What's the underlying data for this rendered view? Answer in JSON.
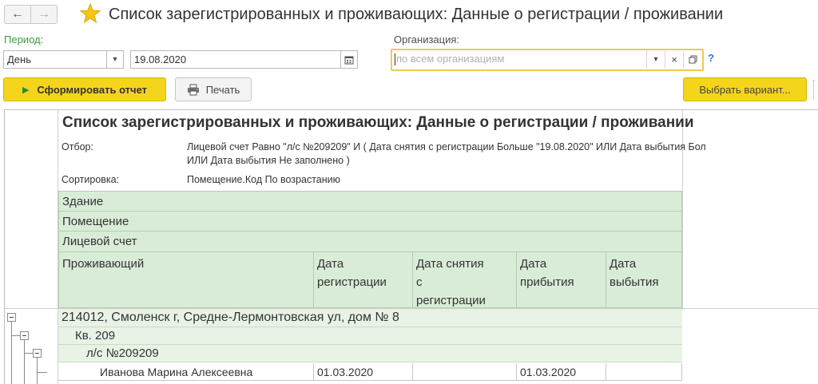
{
  "window": {
    "title": "Список зарегистрированных и проживающих: Данные о регистрации / проживании",
    "nav_back": "←",
    "nav_forward": "→"
  },
  "form": {
    "period_label": "Период:",
    "period_type": "День",
    "date": "19.08.2020",
    "org_label": "Организация:",
    "org_placeholder": "по всем организациям",
    "help": "?"
  },
  "toolbar": {
    "generate_label": "Сформировать отчет",
    "print_label": "Печать",
    "variant_label": "Выбрать вариант..."
  },
  "report": {
    "title": "Список зарегистрированных и проживающих: Данные о регистрации / проживании",
    "filter_label": "Отбор:",
    "filter_line1": "Лицевой счет Равно \"л/с №209209\" И ( Дата снятия с регистрации Больше \"19.08.2020\" ИЛИ Дата выбытия Бол",
    "filter_line2": "ИЛИ Дата выбытия Не заполнено )",
    "sort_label": "Сортировка:",
    "sort_value": "Помещение.Код По возрастанию",
    "header_bands": [
      "Здание",
      "Помещение",
      "Лицевой счет"
    ],
    "columns": {
      "resident": "Проживающий",
      "reg_date_1": "Дата",
      "reg_date_2": "регистрации",
      "unreg_1": "Дата снятия",
      "unreg_2": "с",
      "unreg_3": "регистрации",
      "arrival_1": "Дата",
      "arrival_2": "прибытия",
      "departure_1": "Дата",
      "departure_2": "выбытия"
    },
    "building": "214012, Смоленск г, Средне-Лермонтовская ул, дом № 8",
    "apartment": "Кв. 209",
    "account": "л/с №209209",
    "row": {
      "resident": "Иванова Марина Алексеевна",
      "reg_date": "01.03.2020",
      "unreg_date": "",
      "arrival_date": "01.03.2020",
      "departure_date": ""
    }
  },
  "colors": {
    "accent_yellow": "#f5d51b",
    "label_green": "#3c9a3c",
    "header_green": "#d9ecd7",
    "focus_border": "#f2c94c"
  }
}
